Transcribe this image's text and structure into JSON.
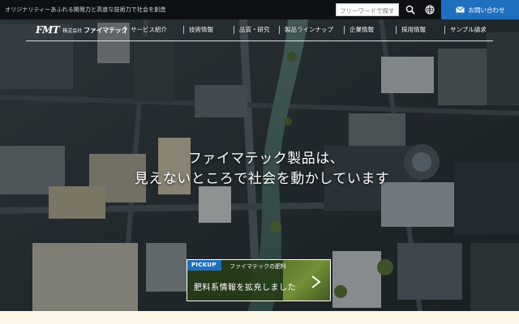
{
  "topbar": {
    "tagline": "オリジナリティーあふれる開発力と高度な技術力で社会を創造",
    "search_placeholder": "フリーワードで探す",
    "contact_label": "お問い合わせ"
  },
  "logo": {
    "mark": "FMT",
    "sub": "株式会社",
    "name": "ファイマテック"
  },
  "nav": {
    "items": [
      {
        "label": "サービス紹介"
      },
      {
        "label": "技術情報"
      },
      {
        "label": "品質・研究"
      },
      {
        "label": "製品ラインナップ"
      },
      {
        "label": "企業情報"
      },
      {
        "label": "採用情報"
      },
      {
        "label": "サンプル請求"
      }
    ]
  },
  "hero": {
    "line1": "ファイマテック製品は、",
    "line2": "見えないところで社会を動かしています"
  },
  "pickup": {
    "tag": "PICKUP",
    "category": "ファイマテックの肥料",
    "title": "肥料系情報を拡充しました"
  },
  "colors": {
    "accent": "#1f6fbe",
    "topbar": "#0e1114"
  },
  "icons": {
    "search": "search-icon",
    "globe": "globe-icon",
    "mail": "mail-icon",
    "arrow": "arrow-right-icon"
  }
}
